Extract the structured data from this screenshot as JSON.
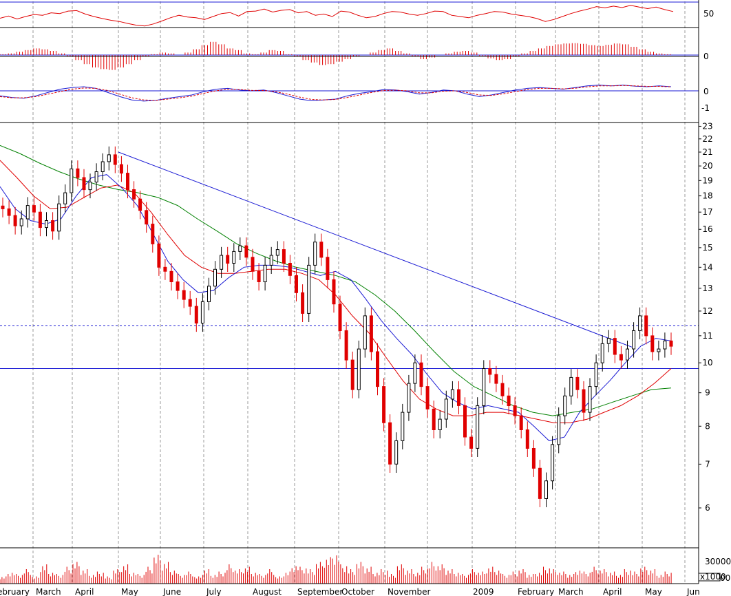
{
  "chart_data": {
    "type": "candlestick",
    "colors": {
      "up": "#000000",
      "down": "#e00000",
      "ma_short": "#1a1ad4",
      "ma_mid": "#e00000",
      "ma_long": "#008000",
      "trendline": "#1a1ad4",
      "grid": "#9a9a9a",
      "volume": "#e00000"
    },
    "x_labels": [
      "ebruary",
      "March",
      "April",
      "May",
      "June",
      "July",
      "August",
      "September",
      "October",
      "November",
      "2009",
      "February",
      "March",
      "April",
      "May",
      "Jun"
    ],
    "panels": {
      "rsi": {
        "ticks": [
          "50"
        ],
        "levels": [
          62,
          30
        ],
        "series": [
          0.43,
          0.52,
          0.4,
          0.5,
          0.58,
          0.55,
          0.65,
          0.62,
          0.72,
          0.74,
          0.6,
          0.5,
          0.42,
          0.35,
          0.3,
          0.22,
          0.15,
          0.12,
          0.2,
          0.32,
          0.45,
          0.55,
          0.48,
          0.45,
          0.38,
          0.5,
          0.62,
          0.66,
          0.52,
          0.7,
          0.72,
          0.8,
          0.68,
          0.75,
          0.78,
          0.65,
          0.7,
          0.55,
          0.6,
          0.5,
          0.72,
          0.68,
          0.55,
          0.45,
          0.5,
          0.62,
          0.7,
          0.68,
          0.6,
          0.55,
          0.62,
          0.72,
          0.7,
          0.55,
          0.5,
          0.45,
          0.55,
          0.62,
          0.7,
          0.68,
          0.6,
          0.55,
          0.5,
          0.42,
          0.3,
          0.38,
          0.5,
          0.62,
          0.72,
          0.8,
          0.9,
          0.85,
          0.92,
          0.86,
          0.95,
          0.88,
          0.82,
          0.88,
          0.78,
          0.7
        ]
      },
      "macd_histogram": {
        "ticks": [
          "0"
        ],
        "zero_level": 0,
        "values": [
          0.05,
          0.1,
          0.2,
          0.3,
          0.4,
          0.35,
          0.25,
          0.1,
          -0.1,
          -0.3,
          -0.55,
          -0.75,
          -0.85,
          -0.9,
          -0.75,
          -0.55,
          -0.3,
          -0.1,
          0.05,
          0.15,
          0.1,
          0.0,
          0.15,
          0.35,
          0.6,
          0.8,
          0.65,
          0.4,
          0.3,
          0.1,
          0.05,
          0.15,
          0.3,
          0.25,
          0.05,
          -0.1,
          -0.3,
          -0.45,
          -0.6,
          -0.55,
          -0.4,
          -0.25,
          -0.1,
          0.0,
          0.15,
          0.3,
          0.4,
          0.25,
          0.1,
          -0.1,
          -0.25,
          -0.15,
          0.0,
          0.1,
          0.2,
          0.25,
          0.15,
          -0.05,
          -0.2,
          -0.3,
          -0.25,
          -0.1,
          0.1,
          0.25,
          0.4,
          0.55,
          0.65,
          0.7,
          0.72,
          0.68,
          0.6,
          0.55,
          0.62,
          0.7,
          0.65,
          0.5,
          0.35,
          0.2,
          0.1,
          0.05
        ]
      },
      "macd": {
        "ticks": [
          "0",
          "-1"
        ],
        "zero_level": 0,
        "macd": [
          -0.3,
          -0.4,
          -0.45,
          -0.3,
          -0.1,
          0.1,
          0.2,
          0.25,
          0.15,
          -0.1,
          -0.35,
          -0.55,
          -0.62,
          -0.58,
          -0.45,
          -0.35,
          -0.25,
          -0.05,
          0.1,
          0.15,
          0.05,
          0.0,
          0.05,
          -0.1,
          -0.3,
          -0.5,
          -0.6,
          -0.55,
          -0.5,
          -0.3,
          -0.15,
          -0.05,
          0.08,
          0.05,
          -0.05,
          -0.2,
          -0.1,
          0.05,
          0.0,
          -0.2,
          -0.35,
          -0.25,
          -0.1,
          0.05,
          0.15,
          0.2,
          0.15,
          0.1,
          0.2,
          0.3,
          0.35,
          0.3,
          0.35,
          0.28,
          0.25,
          0.3,
          0.25
        ],
        "signal": [
          -0.35,
          -0.42,
          -0.42,
          -0.35,
          -0.2,
          -0.05,
          0.1,
          0.17,
          0.15,
          0.02,
          -0.2,
          -0.42,
          -0.55,
          -0.58,
          -0.5,
          -0.42,
          -0.32,
          -0.15,
          0.0,
          0.1,
          0.08,
          0.03,
          0.02,
          -0.05,
          -0.2,
          -0.38,
          -0.52,
          -0.55,
          -0.52,
          -0.4,
          -0.25,
          -0.1,
          0.02,
          0.04,
          0.0,
          -0.12,
          -0.12,
          -0.02,
          0.0,
          -0.1,
          -0.25,
          -0.28,
          -0.18,
          -0.05,
          0.08,
          0.15,
          0.15,
          0.12,
          0.16,
          0.24,
          0.3,
          0.3,
          0.32,
          0.3,
          0.27,
          0.27,
          0.24
        ]
      },
      "price": {
        "ticks": [
          23,
          22,
          21,
          20,
          19,
          18,
          17,
          16,
          15,
          14,
          13,
          12,
          11,
          10,
          9,
          8,
          7,
          6
        ],
        "scale": "log",
        "ylim": [
          5.3,
          24
        ],
        "support_level": 9.8,
        "resistance_level": 11.4,
        "closes": [
          17.2,
          16.8,
          16.2,
          16.6,
          17.4,
          17.0,
          16.1,
          16.5,
          15.9,
          17.5,
          18.2,
          19.8,
          19.2,
          18.4,
          18.9,
          19.6,
          20.3,
          20.8,
          20.1,
          19.5,
          18.4,
          17.8,
          17.1,
          16.3,
          15.2,
          14.0,
          13.8,
          13.3,
          12.9,
          12.5,
          12.2,
          11.5,
          12.4,
          13.1,
          13.9,
          14.6,
          14.2,
          14.8,
          15.1,
          14.5,
          13.8,
          13.3,
          14.1,
          14.6,
          14.9,
          14.2,
          13.6,
          12.8,
          11.9,
          14.1,
          15.3,
          14.5,
          13.4,
          12.3,
          11.2,
          10.1,
          9.1,
          10.5,
          11.8,
          10.4,
          9.2,
          8.1,
          7.0,
          7.6,
          8.4,
          9.3,
          10.0,
          9.2,
          8.5,
          7.9,
          8.2,
          8.8,
          9.1,
          8.6,
          7.7,
          7.4,
          8.6,
          9.8,
          9.6,
          9.3,
          8.9,
          8.6,
          8.3,
          7.9,
          7.4,
          6.9,
          6.2,
          6.6,
          7.5,
          8.3,
          8.9,
          9.5,
          9.1,
          8.4,
          9.2,
          10.0,
          10.7,
          10.9,
          10.3,
          10.1,
          10.5,
          11.2,
          11.8,
          11.0,
          10.4,
          10.5,
          10.8,
          10.6
        ],
        "ma_short": [
          18.6,
          17.2,
          16.5,
          16.3,
          16.6,
          18.0,
          19.2,
          19.4,
          18.5,
          17.4,
          15.8,
          14.3,
          13.4,
          12.8,
          12.9,
          13.5,
          14.0,
          14.1,
          14.1,
          14.0,
          13.8,
          13.6,
          13.8,
          13.4,
          12.5,
          11.6,
          10.9,
          10.3,
          9.6,
          9.0,
          8.7,
          8.5,
          8.6,
          8.5,
          8.4,
          8.0,
          7.6,
          7.7,
          8.4,
          8.9,
          9.4,
          10.0,
          10.6,
          10.9,
          10.8
        ],
        "ma_mid": [
          20.4,
          19.2,
          18.0,
          17.2,
          17.3,
          17.9,
          18.5,
          18.7,
          18.2,
          17.0,
          15.7,
          14.6,
          14.0,
          13.7,
          13.7,
          13.8,
          13.9,
          13.9,
          13.7,
          13.4,
          12.7,
          11.8,
          11.1,
          10.2,
          9.4,
          8.8,
          8.5,
          8.3,
          8.3,
          8.4,
          8.4,
          8.3,
          8.2,
          8.1,
          8.1,
          8.2,
          8.4,
          8.6,
          8.9,
          9.3,
          9.8
        ],
        "ma_long": [
          21.5,
          20.9,
          20.2,
          19.6,
          19.1,
          18.7,
          18.4,
          18.2,
          17.9,
          17.4,
          16.6,
          15.9,
          15.2,
          14.7,
          14.3,
          14.0,
          13.8,
          13.6,
          13.3,
          12.7,
          12.0,
          11.2,
          10.4,
          9.7,
          9.2,
          8.9,
          8.6,
          8.4,
          8.3,
          8.4,
          8.5,
          8.7,
          8.9,
          9.1,
          9.15
        ]
      },
      "volume": {
        "ticks": [
          "30000",
          "x1000",
          "00"
        ],
        "values": [
          3,
          5,
          4,
          6,
          3,
          8,
          5,
          4,
          7,
          9,
          6,
          4,
          5,
          3,
          6,
          8,
          5,
          4,
          7,
          12,
          9,
          6,
          4,
          5,
          3,
          6,
          4,
          5,
          8,
          6,
          7,
          5,
          4,
          6,
          3,
          5,
          8,
          7,
          6,
          9,
          11,
          13,
          8,
          6,
          9,
          7,
          5,
          6,
          4,
          8,
          6,
          5,
          7,
          9,
          8,
          6,
          5,
          4,
          6,
          5,
          7,
          6,
          4,
          5,
          6,
          4,
          5,
          7,
          6,
          5,
          4,
          6,
          5,
          7,
          6,
          5,
          4,
          6,
          5,
          7,
          6,
          4,
          5
        ]
      }
    }
  }
}
